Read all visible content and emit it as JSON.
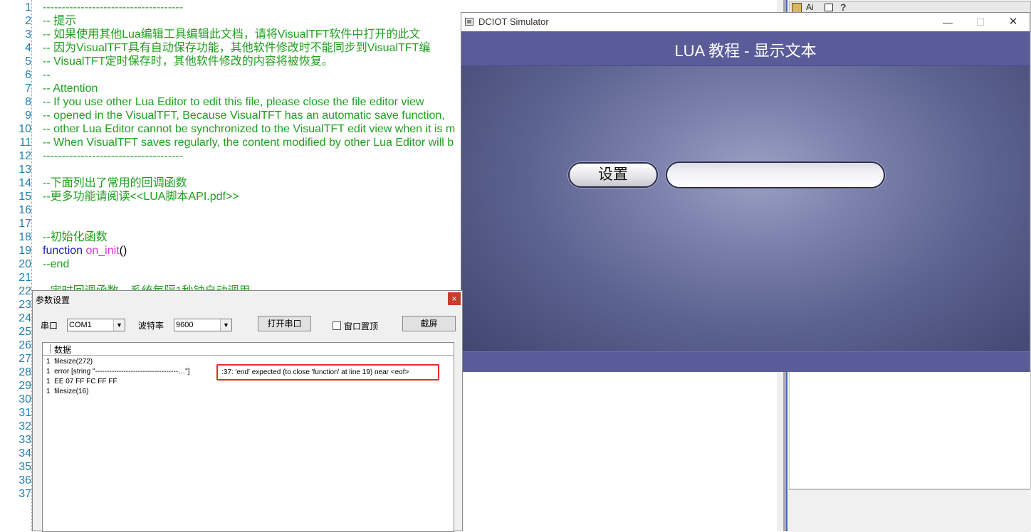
{
  "editor": {
    "line_numbers": [
      "1",
      "2",
      "3",
      "4",
      "5",
      "6",
      "7",
      "8",
      "9",
      "10",
      "11",
      "12",
      "13",
      "14",
      "15",
      "16",
      "17",
      "18",
      "19",
      "20",
      "21",
      "22",
      "23",
      "24",
      "25",
      "26",
      "27",
      "28",
      "29",
      "30",
      "31",
      "32",
      "33",
      "34",
      "35",
      "36",
      "37"
    ],
    "lines": [
      {
        "n": 1,
        "parts": [
          {
            "cls": "c-comment",
            "text": "-------------------------------------"
          }
        ]
      },
      {
        "n": 2,
        "parts": [
          {
            "cls": "c-comment",
            "text": "-- 提示"
          }
        ]
      },
      {
        "n": 3,
        "parts": [
          {
            "cls": "c-comment",
            "text": "-- 如果使用其他Lua编辑工具编辑此文档，请将VisualTFT软件中打开的此文"
          }
        ]
      },
      {
        "n": 4,
        "parts": [
          {
            "cls": "c-comment",
            "text": "-- 因为VisualTFT具有自动保存功能，其他软件修改时不能同步到VisualTFT编"
          }
        ]
      },
      {
        "n": 5,
        "parts": [
          {
            "cls": "c-comment",
            "text": "-- VisualTFT定时保存时，其他软件修改的内容将被恢复。"
          }
        ]
      },
      {
        "n": 6,
        "parts": [
          {
            "cls": "c-comment",
            "text": "--"
          }
        ]
      },
      {
        "n": 7,
        "parts": [
          {
            "cls": "c-comment",
            "text": "-- Attention"
          }
        ]
      },
      {
        "n": 8,
        "parts": [
          {
            "cls": "c-comment",
            "text": "-- If you use other Lua Editor to edit this file, please close the file editor view"
          }
        ]
      },
      {
        "n": 9,
        "parts": [
          {
            "cls": "c-comment",
            "text": "-- opened in the VisualTFT, Because VisualTFT has an automatic save function,"
          }
        ]
      },
      {
        "n": 10,
        "parts": [
          {
            "cls": "c-comment",
            "text": "-- other Lua Editor cannot be synchronized to the VisualTFT edit view when it is m"
          }
        ]
      },
      {
        "n": 11,
        "parts": [
          {
            "cls": "c-comment",
            "text": "-- When VisualTFT saves regularly, the content modified by other Lua Editor will b"
          }
        ]
      },
      {
        "n": 12,
        "parts": [
          {
            "cls": "c-comment",
            "text": "-------------------------------------"
          }
        ]
      },
      {
        "n": 14,
        "parts": [
          {
            "cls": "c-comment",
            "text": "--下面列出了常用的回调函数"
          }
        ]
      },
      {
        "n": 15,
        "parts": [
          {
            "cls": "c-comment",
            "text": "--更多功能请阅读<<LUA脚本API.pdf>>"
          }
        ]
      },
      {
        "n": 18,
        "parts": [
          {
            "cls": "c-comment",
            "text": "--初始化函数"
          }
        ]
      },
      {
        "n": 19,
        "parts": [
          {
            "cls": "c-kw",
            "text": "function "
          },
          {
            "cls": "c-fn",
            "text": "on_init"
          },
          {
            "cls": "c-plain",
            "text": "()"
          }
        ]
      },
      {
        "n": 20,
        "parts": [
          {
            "cls": "c-comment",
            "text": "--end"
          }
        ]
      },
      {
        "n": 22,
        "parts": [
          {
            "cls": "c-comment",
            "text": "--定时回调函数，系统每隔1秒钟自动调用。"
          }
        ]
      }
    ]
  },
  "right_panel": {
    "toolbar_text": "Ai",
    "toolbar_help": "?"
  },
  "simulator": {
    "window_title": "DCIOT Simulator",
    "minimize_glyph": "—",
    "maximize_glyph": "☐",
    "close_glyph": "✕",
    "screen_title": "LUA 教程 - 显示文本",
    "set_button_label": "设置",
    "text_field_value": ""
  },
  "dialog": {
    "title": "参数设置",
    "close_glyph": "×",
    "port_label": "串口",
    "port_value": "COM1",
    "baud_label": "波特率",
    "baud_value": "9600",
    "open_port_button": "打开串口",
    "pin_window_label": "窗口置顶",
    "pin_window_checked": false,
    "screenshot_button": "截屏",
    "log_header": "数据",
    "log_lines": [
      "1  filesize(272)",
      "1  error [string \"-----------------------------------…\"]",
      "1  EE 07 FF FC FF FF",
      "1  filesize(16)"
    ],
    "error_detail": ":37: 'end' expected (to close 'function' at line 19) near <eof>"
  },
  "colors": {
    "comment": "#1fa01f",
    "keyword": "#2020c0",
    "function_name": "#d23ad2",
    "line_number": "#1f7fb6",
    "error_highlight": "#e0302a",
    "simulator_header": "#5a5c9a"
  }
}
